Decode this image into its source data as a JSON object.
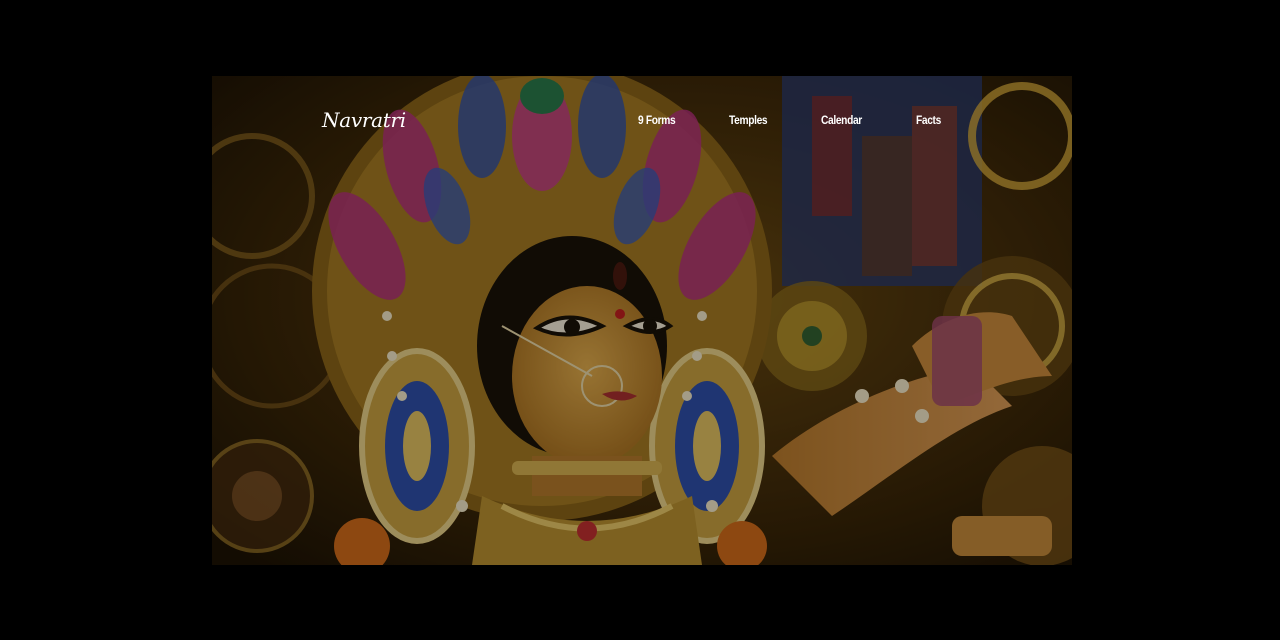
{
  "header": {
    "logo": "Navratri",
    "nav": [
      {
        "label": "9 Forms"
      },
      {
        "label": "Temples"
      },
      {
        "label": "Calendar"
      },
      {
        "label": "Facts"
      }
    ]
  },
  "hero": {
    "image": "goddess-durga-idol",
    "overlay": "dark"
  },
  "colors": {
    "page_background": "#000000",
    "nav_text": "#ffffff",
    "gold": "#c9a23a",
    "crown_magenta": "#b3307a",
    "crown_blue": "#2e4fa8",
    "skin": "#d9a24a"
  }
}
